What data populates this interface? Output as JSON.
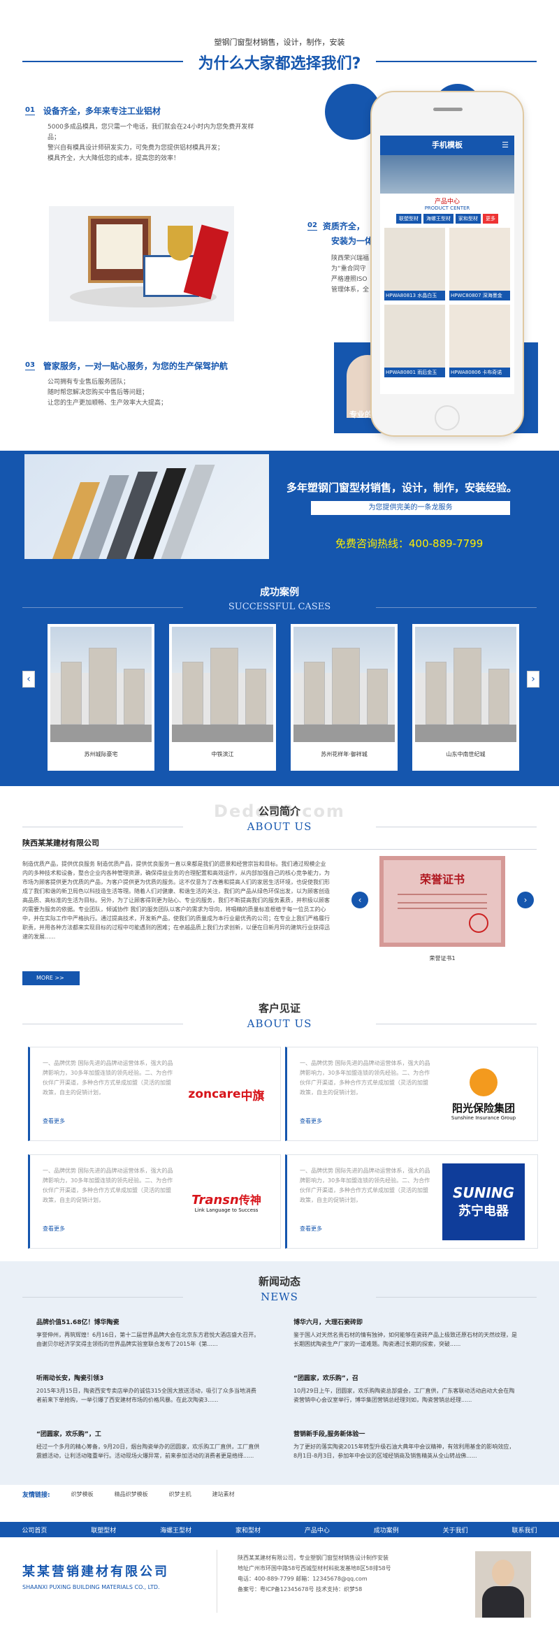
{
  "top": {
    "subtitle": "塑钢门窗型材销售，设计，制作，安装",
    "title": "为什么大家都选择我们?"
  },
  "features": [
    {
      "num": "01",
      "title": "设备齐全，多年来专注工业铝材",
      "lines": [
        "5000多成品模具，您只需一个电话，我们就会在24小时内为您免费开发样品；",
        "警兴自有模具设计师研发实力，可免费为您提供铝材模具开发；",
        "模具齐全，大大降低您的成本，提高您的效率！"
      ]
    },
    {
      "num": "02",
      "title": "资质齐全，",
      "title2": "安装为一体",
      "lines": [
        "陕西荣兴瑞福",
        "为“重合同守",
        "严格遵照ISO",
        "管理体系，全"
      ]
    },
    {
      "num": "03",
      "title": "管家服务，一对一贴心服务，为您的生产保驾护航",
      "lines": [
        "公司拥有专业售后服务团队；",
        "随时帮您解决您购买中售后等问题；",
        "让您的生产更加顺畅、生产效率大大提高；"
      ]
    }
  ],
  "phone": {
    "header": "手机模板",
    "center_cn": "产品中心",
    "center_en": "PRODUCT CENTER",
    "tabs": [
      "联塑型材",
      "海螺王型材",
      "家和型材",
      "更多"
    ],
    "products": [
      "HPWA80813 水晶白玉",
      "HPWC80807 深海墨金",
      "HPWA80801 雨后金玉",
      "HPWA80806 卡布奇诺"
    ]
  },
  "special": "专业的",
  "banner": {
    "main": "多年塑钢门窗型材销售，设计，制作，安装经验。",
    "sub": "为您提供完美的一条龙服务",
    "hotline": "免费咨询热线：400-889-7799"
  },
  "cases": {
    "title": "成功案例",
    "sub": "SUCCESSFUL CASES",
    "items": [
      "苏州城际豪宅",
      "中铁滨江",
      "苏州花样年·御祥城",
      "山东中南世纪城"
    ]
  },
  "watermark": "Dede58.com",
  "about": {
    "title": "公司简介",
    "sub": "ABOUT US",
    "company": "陕西某某建材有限公司",
    "text": "制造优质产品，提供优良服务 制造优质产品，提供优良服务一直以来都是我们的愿景和经营宗旨和目标。我们通过规模企业内的多种技术和设备，整合企业内各种管理资源，确保得益业务的合理配置和高效运作，从内部加强自己的核心竞争能力，为市场为顾客提供更为优质的产品，为客户提供更为优质的服务。这不仅意为了改善和提高人们的家居生活环境，也促使我们形成了我们和谐的新卫局色以科技造生活等理。随着人们对健康、和谐生活的关注，我们的产品从绿色环保出发，以为顾客创造高品质、高标准的生活为目标。另外，为了让顾客得到更为贴心、专业的服务，我们不断提高我们的服务素质，并积极以顾客的需要为服务的依据。专业团队，倾诚协作 我们的服务团队以客户的需求为导向，将唱精的质量标准根植于每一位员工的心中，并在实际工作中严格执行。通过提高技术，开发新产品，使我们的质量成为本行业最优秀的公司；在专业上我们严格履行职责，并用各种方法都来实现目标的过程中可能遇到的困难；在卓越品质上我们力求创新，以便在日新月异的建筑行业获得迅速的发展......",
    "more": "MORE >>",
    "cert_title": "荣誉证书",
    "cert_caption": "荣誉证书1"
  },
  "testimonials": {
    "title": "客户见证",
    "sub": "ABOUT US",
    "text": "一、品牌优势 国际先进的品牌动运营体系，强大的品牌影响力，30多年加盟连锁的领先经验。二、为合作伙伴广开渠道，多种合作方式单成加盟（灵活的加盟政策，自主的促销计划，",
    "more": "查看更多",
    "logos": {
      "zoncare_en": "zoncare",
      "zoncare_cn": "中旗",
      "sunshine_cn": "阳光保险集团",
      "sunshine_en": "Sunshine Insurance Group",
      "transn_en": "Transn",
      "transn_cn": "传神",
      "transn_tag": "Link Language to Success",
      "suning_en": "SUNING",
      "suning_cn": "苏宁电器"
    }
  },
  "news": {
    "title": "新闻动态",
    "sub": "NEWS",
    "items": [
      {
        "t": "品牌价值51.68亿！博华陶瓷",
        "d": "享誉伸州，再筑辉煌！6月16日，第十二届世界品牌大会在北京东方君悦大酒店盛大召开。由谢贝尔经济学奖得主领衔的世界品牌实验室联合发布了2015年《第......"
      },
      {
        "t": "博华六月，大理石瓷砖即",
        "d": "鉴于国人对天然名贵石材的情有独钟，如何能够在瓷砖产品上极致还原石材的天然纹理，是长期困扰陶瓷生产厂家的一道难题。陶瓷通过长期的探索，突破......"
      },
      {
        "t": "听雨动长安，陶瓷引领3",
        "d": "2015年3月15日，陶瓷西安专卖店举办的诚信315全国大放送活动，吸引了众多当地消费者前来下单抢购，一举引爆了西安建材市场的价格风暴。在此次陶瓷3......"
      },
      {
        "t": "“团圆家，欢乐购”，召",
        "d": "10月29日上午，团圆家，欢乐购陶瓷总部盛会，工厂直供，广东客联动活动启动大会在陶瓷营销中心会议室举行，博华集团营销总经理刘如，陶瓷营销总经理......"
      },
      {
        "t": "“团圆家，欢乐购”，工",
        "d": "经过一个多月的精心筹备，9月20日，烟台陶瓷举办的团圆家，欢乐购工厂直供，工厂直供震撼活动，让利活动隆重举行。活动现场火爆异常，前来参加活动的消费者更是络绎......"
      },
      {
        "t": "营销新手段,服务新体验一",
        "d": "为了更好的落实陶瓷2015年转型升级石油大典年中会议精神，有效利用基金的影响效应，8月1日-8月3日，参加年中会议的区域经销商及销售精英从全山转战佛......"
      }
    ]
  },
  "links": {
    "label": "友情链接:",
    "items": [
      "织梦模板",
      "精品织梦模板",
      "织梦主机",
      "建站素材"
    ]
  },
  "nav": [
    "公司首页",
    "联塑型材",
    "海螺王型材",
    "家和型材",
    "产品中心",
    "成功案例",
    "关于我们",
    "联系我们"
  ],
  "footer": {
    "logo_cn": "某某营销建材有限公司",
    "logo_en": "SHAANXI PUXING BUILDING MATERIALS CO., LTD.",
    "lines": [
      "陕西某某建材有限公司，专业塑钢门窗型材销售设计制作安装",
      "地址广州市环国中路58号西城型材村料批发基地8区58排58号",
      "电话：400-889-7799  邮箱：12345678@qq.com",
      "备案号：粤ICP备12345678号    技术支持：织梦58"
    ]
  }
}
